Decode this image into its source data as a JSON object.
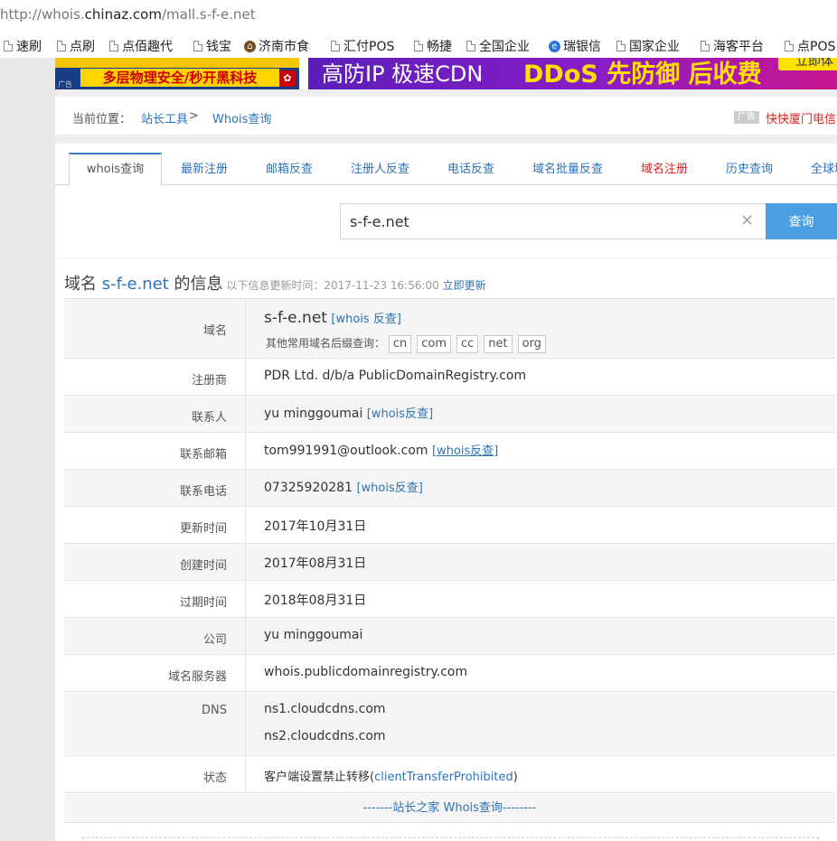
{
  "browser": {
    "url_prefix": "http://whois.",
    "url_host": "chinaz.com",
    "url_path": "/mall.s-f-e.net"
  },
  "bookmarks": [
    {
      "label": "速刷",
      "icon": "doc-icon"
    },
    {
      "label": "点刷",
      "icon": "doc-icon"
    },
    {
      "label": "点佰趣代",
      "icon": "doc-icon"
    },
    {
      "label": "钱宝",
      "icon": "doc-icon"
    },
    {
      "label": "济南市食",
      "icon": "school-icon"
    },
    {
      "label": "汇付POS",
      "icon": "doc-icon"
    },
    {
      "label": "畅捷",
      "icon": "doc-icon"
    },
    {
      "label": "全国企业",
      "icon": "doc-icon"
    },
    {
      "label": "瑞银信",
      "icon": "e-icon"
    },
    {
      "label": "国家企业",
      "icon": "doc-icon"
    },
    {
      "label": "海客平台",
      "icon": "doc-icon"
    },
    {
      "label": "点POS",
      "icon": "doc-icon"
    }
  ],
  "ads": {
    "left_text": "多层物理安全/秒开黑科技",
    "left_tag": "广告",
    "right_text_1": "高防IP 极速CDN",
    "right_text_2": "DDoS 先防御 后收费",
    "right_button": "立即体"
  },
  "breadcrumb": {
    "label": "当前位置：",
    "link1": "站长工具",
    "sep": ">",
    "link2": "Whois查询",
    "ad_tag": "广告",
    "ad_text": "快快厦门电信"
  },
  "tabs": [
    {
      "label": "whois查询",
      "active": true
    },
    {
      "label": "最新注册"
    },
    {
      "label": "邮箱反查"
    },
    {
      "label": "注册人反查"
    },
    {
      "label": "电话反查"
    },
    {
      "label": "域名批量反查"
    },
    {
      "label": "域名注册",
      "highlight": "#e02020"
    },
    {
      "label": "历史查询"
    },
    {
      "label": "全球域"
    }
  ],
  "search": {
    "value": "s-f-e.net",
    "clear_glyph": "✕",
    "button": "查询"
  },
  "heading": {
    "prefix": "域名 ",
    "domain": "s-f-e.net",
    "suffix": " 的信息",
    "update_label": " 以下信息更新时间：2017-11-23 16:56:00 ",
    "update_link": "立即更新"
  },
  "whois": {
    "domain_label": "域名",
    "domain_value": "s-f-e.net",
    "domain_link": "[whois 反查]",
    "suffix_label": "其他常用域名后缀查询：",
    "suffixes": [
      "cn",
      "com",
      "cc",
      "net",
      "org"
    ],
    "registrar_label": "注册商",
    "registrar_value": "PDR Ltd. d/b/a PublicDomainRegistry.com",
    "contact_label": "联系人",
    "contact_value": "yu minggoumai",
    "contact_link": "[whois反查]",
    "email_label": "联系邮箱",
    "email_value": "tom991991@outlook.com",
    "email_link": "[whois反查]",
    "phone_label": "联系电话",
    "phone_value": "07325920281",
    "phone_link": "[whois反查]",
    "updated_label": "更新时间",
    "updated_value": "2017年10月31日",
    "created_label": "创建时间",
    "created_value": "2017年08月31日",
    "expires_label": "过期时间",
    "expires_value": "2018年08月31日",
    "company_label": "公司",
    "company_value": "yu minggoumai",
    "server_label": "域名服务器",
    "server_value": "whois.publicdomainregistry.com",
    "dns_label": "DNS",
    "dns_values": [
      "ns1.cloudcdns.com",
      "ns2.cloudcdns.com"
    ],
    "status_label": "状态",
    "status_prefix": "客户端设置禁止转移(",
    "status_link": "clientTransferProhibited",
    "status_suffix": ")",
    "footer": "-------站长之家 Whois查询--------"
  },
  "colors": {
    "link": "#2e72b7",
    "accent_button": "#4a9ee2",
    "red": "#e02020"
  }
}
